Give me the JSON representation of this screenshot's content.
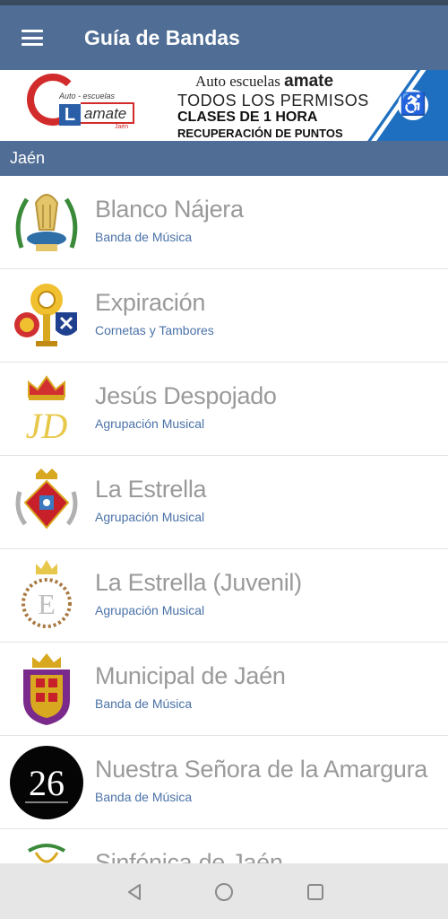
{
  "app_bar": {
    "title": "Guía de Bandas",
    "menu_icon": "hamburger-menu-icon"
  },
  "banner": {
    "logo_small": "Auto - escuelas",
    "logo_letter": "L",
    "logo_word": "amate",
    "logo_city": "Jaén",
    "brand_prefix": "Auto escuelas",
    "brand_name": "amate",
    "line1": "TODOS LOS PERMISOS",
    "line2": "CLASES DE 1 HORA",
    "line3": "RECUPERACIÓN DE PUNTOS",
    "accessibility_icon": "wheelchair-icon",
    "stripe_color": "#1e6fc0"
  },
  "section": {
    "label": "Jaén"
  },
  "bands": [
    {
      "name": "Blanco Nájera",
      "type": "Banda de Música",
      "crest_icon": "lyre-laurel-crest-icon"
    },
    {
      "name": "Expiración",
      "type": "Cornetas y Tambores",
      "crest_icon": "monstrance-shields-crest-icon"
    },
    {
      "name": "Jesús Despojado",
      "type": "Agrupación Musical",
      "crest_icon": "crown-jd-monogram-icon"
    },
    {
      "name": "La Estrella",
      "type": "Agrupación Musical",
      "crest_icon": "red-star-shield-crest-icon"
    },
    {
      "name": "La Estrella (Juvenil)",
      "type": "Agrupación Musical",
      "crest_icon": "crown-thorn-wreath-crest-icon"
    },
    {
      "name": "Municipal de Jaén",
      "type": "Banda de Música",
      "crest_icon": "jaen-coat-of-arms-icon"
    },
    {
      "name": "Nuestra Señora de la Amargura",
      "type": "Banda de Música",
      "crest_icon": "black-circle-26-logo-icon"
    },
    {
      "name": "Sinfónica de Jaén",
      "type": "",
      "crest_icon": "lyre-crest-icon"
    }
  ],
  "colors": {
    "primary": "#4f6d95",
    "status_bar": "#394a5e",
    "band_name": "#9a9a9a",
    "band_type": "#4a72a8",
    "nav_bar": "#e6e6e6"
  },
  "navigation": {
    "back_icon": "back-triangle-icon",
    "home_icon": "home-circle-icon",
    "recents_icon": "recents-square-icon"
  }
}
